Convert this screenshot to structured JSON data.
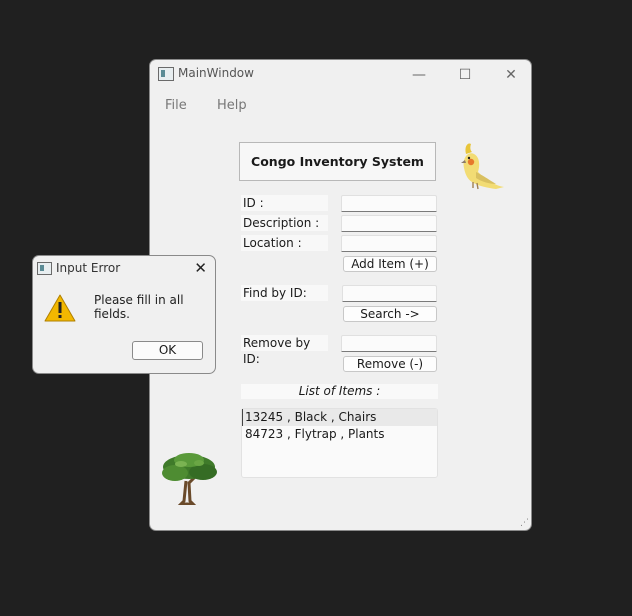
{
  "window": {
    "title": "MainWindow",
    "controls": {
      "minimize": "—",
      "maximize": "☐",
      "close": "✕"
    }
  },
  "menu": {
    "file": "File",
    "help": "Help"
  },
  "header": {
    "title": "Congo Inventory System"
  },
  "form": {
    "id_label": "ID :",
    "description_label": "Description :",
    "location_label": "Location :",
    "id_value": "",
    "description_value": "",
    "location_value": "",
    "add_button": "Add Item (+)"
  },
  "find": {
    "label": "Find by ID:",
    "value": "",
    "button": "Search ->"
  },
  "remove": {
    "label": "Remove by ID:",
    "value": "",
    "button": "Remove (-)"
  },
  "list": {
    "label": "List of Items :",
    "items": [
      "13245 , Black , Chairs",
      "84723 , Flytrap , Plants"
    ],
    "selected_index": 0
  },
  "dialog": {
    "title": "Input Error",
    "close": "✕",
    "message": "Please fill in all fields.",
    "ok_button": "OK"
  },
  "images": {
    "top_right": "cockatiel bird",
    "bottom_left": "tree"
  }
}
